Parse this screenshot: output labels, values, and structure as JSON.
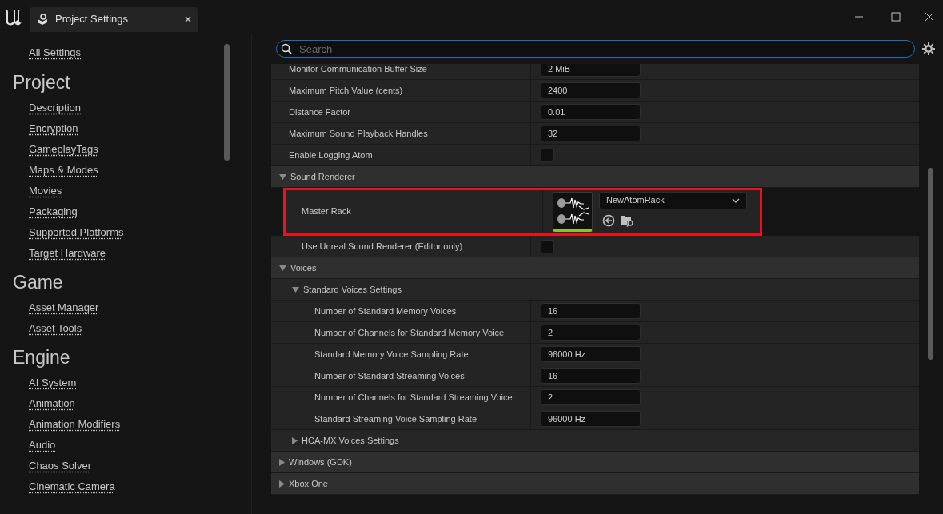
{
  "window": {
    "tab_title": "Project Settings"
  },
  "sidebar": {
    "top_link": "All Settings",
    "sections": [
      {
        "title": "Project",
        "items": [
          "Description",
          "Encryption",
          "GameplayTags",
          "Maps & Modes",
          "Movies",
          "Packaging",
          "Supported Platforms",
          "Target Hardware"
        ]
      },
      {
        "title": "Game",
        "items": [
          "Asset Manager",
          "Asset Tools"
        ]
      },
      {
        "title": "Engine",
        "items": [
          "AI System",
          "Animation",
          "Animation Modifiers",
          "Audio",
          "Chaos Solver",
          "Cinematic Camera"
        ]
      }
    ]
  },
  "search": {
    "placeholder": "Search"
  },
  "rows": [
    {
      "kind": "property",
      "label": "Monitor Communication Buffer Size",
      "value": {
        "kind": "text",
        "text": "2 MiB"
      }
    },
    {
      "kind": "property",
      "label": "Maximum Pitch Value (cents)",
      "value": {
        "kind": "text",
        "text": "2400"
      }
    },
    {
      "kind": "property",
      "label": "Distance Factor",
      "value": {
        "kind": "text",
        "text": "0.01"
      }
    },
    {
      "kind": "property",
      "label": "Maximum Sound Playback Handles",
      "value": {
        "kind": "text",
        "text": "32"
      }
    },
    {
      "kind": "property",
      "label": "Enable Logging Atom",
      "value": {
        "kind": "checkbox",
        "checked": false
      }
    },
    {
      "kind": "category",
      "label": "Sound Renderer",
      "expanded": true,
      "children": [
        {
          "kind": "property",
          "label": "Master Rack",
          "highlighted": true,
          "value": {
            "kind": "asset",
            "text": "NewAtomRack"
          }
        },
        {
          "kind": "property",
          "label": "Use Unreal Sound Renderer (Editor only)",
          "value": {
            "kind": "checkbox",
            "checked": false
          }
        }
      ]
    },
    {
      "kind": "category",
      "label": "Voices",
      "expanded": true,
      "children": [
        {
          "kind": "category",
          "label": "Standard Voices Settings",
          "expanded": true,
          "children": [
            {
              "kind": "property",
              "label": "Number of Standard Memory Voices",
              "value": {
                "kind": "text",
                "text": "16"
              }
            },
            {
              "kind": "property",
              "label": "Number of Channels for Standard Memory Voice",
              "value": {
                "kind": "text",
                "text": "2"
              }
            },
            {
              "kind": "property",
              "label": "Standard Memory Voice Sampling Rate",
              "value": {
                "kind": "text",
                "text": "96000 Hz"
              }
            },
            {
              "kind": "property",
              "label": "Number of Standard Streaming Voices",
              "value": {
                "kind": "text",
                "text": "16"
              }
            },
            {
              "kind": "property",
              "label": "Number of Channels for Standard Streaming Voice",
              "value": {
                "kind": "text",
                "text": "2"
              }
            },
            {
              "kind": "property",
              "label": "Standard Streaming Voice Sampling Rate",
              "value": {
                "kind": "text",
                "text": "96000 Hz"
              }
            }
          ]
        },
        {
          "kind": "category",
          "label": "HCA-MX Voices Settings",
          "expanded": false
        }
      ]
    },
    {
      "kind": "category",
      "label": "Windows (GDK)",
      "expanded": false
    },
    {
      "kind": "category",
      "label": "Xbox One",
      "expanded": false
    }
  ]
}
